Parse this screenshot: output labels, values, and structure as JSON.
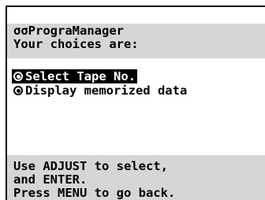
{
  "header": {
    "title": "σσPrograManager",
    "prompt": "Your choices are:"
  },
  "menu": {
    "items": [
      {
        "label": "Select Tape No.",
        "selected": true
      },
      {
        "label": "Display memorized data",
        "selected": false
      }
    ]
  },
  "help": {
    "line1": "Use ADJUST to select,",
    "line2": "and ENTER.",
    "line3": "Press MENU to go back."
  },
  "colors": {
    "band": "#d6d6d6",
    "text": "#000000",
    "selection_bg": "#000000",
    "selection_text": "#ffffff"
  }
}
